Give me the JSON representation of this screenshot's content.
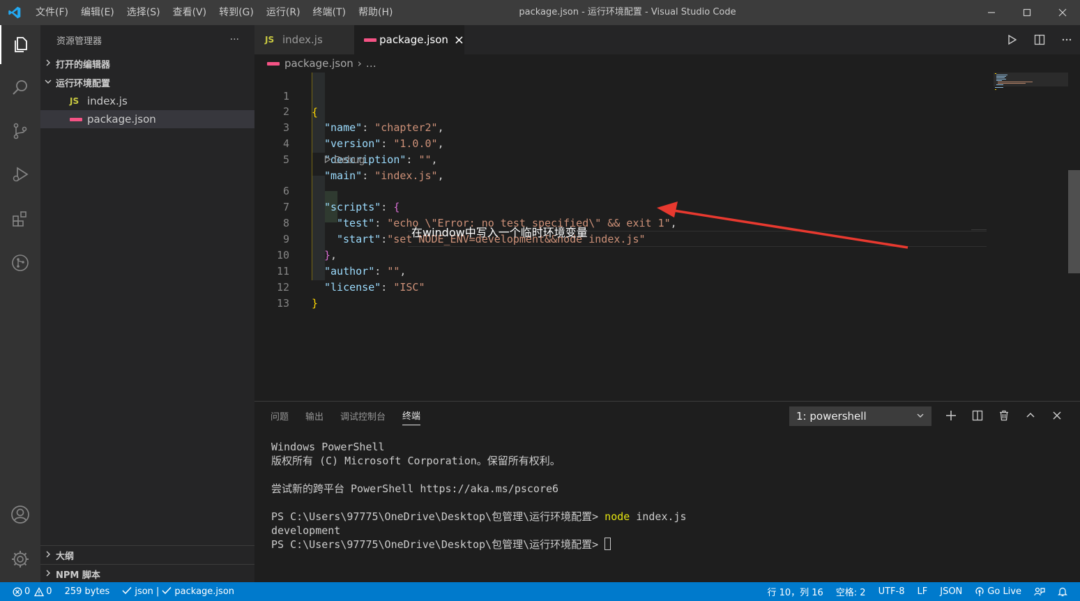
{
  "titlebar": {
    "menu": [
      "文件(F)",
      "编辑(E)",
      "选择(S)",
      "查看(V)",
      "转到(G)",
      "运行(R)",
      "终端(T)",
      "帮助(H)"
    ],
    "title": "package.json - 运行环境配置 - Visual Studio Code"
  },
  "sidebar": {
    "header": "资源管理器",
    "more": "···",
    "open_editors": "打开的编辑器",
    "folder": "运行环境配置",
    "files": [
      {
        "icon": "JS",
        "name": "index.js"
      },
      {
        "name": "package.json"
      }
    ],
    "outline": "大纲",
    "npm_scripts": "NPM 脚本"
  },
  "tabs": [
    {
      "icon": "JS",
      "label": "index.js"
    },
    {
      "label": "package.json",
      "close": "×"
    }
  ],
  "breadcrumb": {
    "file": "package.json",
    "sep": "›",
    "rest": "…"
  },
  "editor": {
    "codelens": "Debug",
    "lines": {
      "n1": "1",
      "n2": "2",
      "n3": "3",
      "n4": "4",
      "n5": "5",
      "n6": "6",
      "n7": "7",
      "n8": "8",
      "n9": "9",
      "n10": "10",
      "n11": "11",
      "n12": "12",
      "n13": "13",
      "l2k": "\"name\"",
      "l2v": "\"chapter2\"",
      "l3k": "\"version\"",
      "l3v": "\"1.0.0\"",
      "l4k": "\"description\"",
      "l4v": "\"\"",
      "l5k": "\"main\"",
      "l5v": "\"index.js\"",
      "l6k": "\"scripts\"",
      "l7k": "\"test\"",
      "l7v": "\"echo \\\"Error: no test specified\\\" && exit 1\"",
      "l8k": "\"start\"",
      "l8v": "\"set NODE_ENV=development&&node index.js\"",
      "l10k": "\"author\"",
      "l10v": "\"\"",
      "l11k": "\"license\"",
      "l11v": "\"ISC\""
    },
    "annotation": "在window中写入一个临时环境变量"
  },
  "panel": {
    "tabs": [
      "问题",
      "输出",
      "调试控制台",
      "终端"
    ],
    "terminal_select": "1: powershell",
    "terminal_lines": [
      "Windows PowerShell",
      "版权所有 (C) Microsoft Corporation。保留所有权利。",
      "",
      "尝试新的跨平台 PowerShell https://aka.ms/pscore6",
      "",
      "PS C:\\Users\\97775\\OneDrive\\Desktop\\包管理\\运行环境配置> ",
      "development",
      "PS C:\\Users\\97775\\OneDrive\\Desktop\\包管理\\运行环境配置> "
    ],
    "command_node": "node",
    "command_args": " index.js"
  },
  "statusbar": {
    "errors": "0",
    "warnings": "0",
    "size": "259 bytes",
    "json_check": "json |",
    "file_check": "package.json",
    "position": "行 10，列 16",
    "spaces": "空格: 2",
    "encoding": "UTF-8",
    "eol": "LF",
    "language": "JSON",
    "golive": "Go Live"
  },
  "colors": {
    "accent": "#007acc",
    "json_icon": "#f55385",
    "js_icon": "#cbcb41",
    "arrow": "#e8392f"
  }
}
